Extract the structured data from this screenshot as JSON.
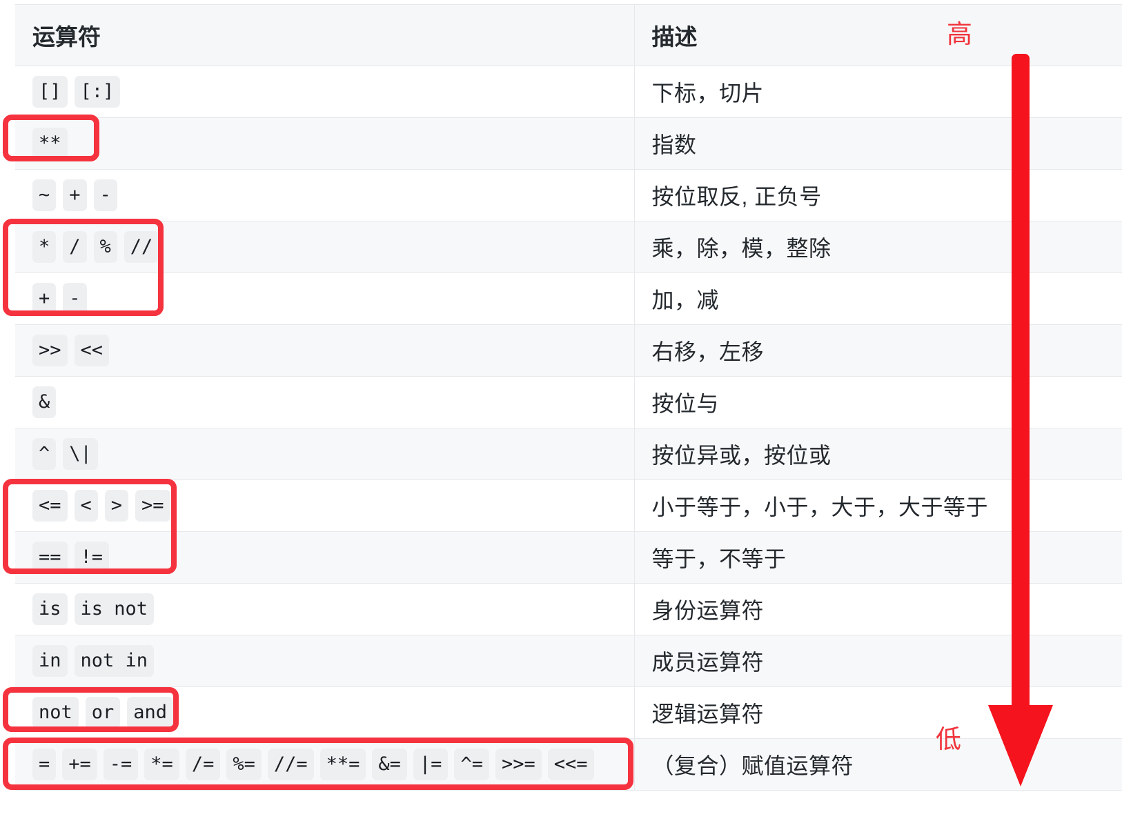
{
  "table": {
    "columns": [
      {
        "key": "operator",
        "label": "运算符"
      },
      {
        "key": "description",
        "label": "描述"
      }
    ],
    "rows": [
      {
        "tokens": [
          "[]",
          "[:]"
        ],
        "description": "下标，切片"
      },
      {
        "tokens": [
          "**"
        ],
        "description": "指数"
      },
      {
        "tokens": [
          "~",
          "+",
          "-"
        ],
        "description": "按位取反, 正负号"
      },
      {
        "tokens": [
          "*",
          "/",
          "%",
          "//"
        ],
        "description": "乘，除，模，整除"
      },
      {
        "tokens": [
          "+",
          "-"
        ],
        "description": "加，减"
      },
      {
        "tokens": [
          ">>",
          "<<"
        ],
        "description": "右移，左移"
      },
      {
        "tokens": [
          "&"
        ],
        "description": "按位与"
      },
      {
        "tokens": [
          "^",
          "\\|"
        ],
        "description": "按位异或，按位或"
      },
      {
        "tokens": [
          "<=",
          "<",
          ">",
          ">="
        ],
        "description": "小于等于，小于，大于，大于等于"
      },
      {
        "tokens": [
          "==",
          "!="
        ],
        "description": "等于，不等于"
      },
      {
        "tokens": [
          "is",
          "is not"
        ],
        "description": "身份运算符"
      },
      {
        "tokens": [
          "in",
          "not in"
        ],
        "description": "成员运算符"
      },
      {
        "tokens": [
          "not",
          "or",
          "and"
        ],
        "description": "逻辑运算符"
      },
      {
        "tokens": [
          "=",
          "+=",
          "-=",
          "*=",
          "/=",
          "%=",
          "//=",
          "**=",
          "&=",
          "|=",
          "^=",
          ">>=",
          "<<="
        ],
        "description": "（复合）赋值运算符"
      }
    ]
  },
  "annotations": {
    "accent_color": "#f5333f",
    "priority_high_label": "高",
    "priority_low_label": "低",
    "arrow_direction": "down",
    "boxes": [
      {
        "id": "box-exponent",
        "rows": [
          1,
          1
        ]
      },
      {
        "id": "box-muldiv-addsub",
        "rows": [
          3,
          4
        ]
      },
      {
        "id": "box-comparison",
        "rows": [
          8,
          9
        ]
      },
      {
        "id": "box-logical",
        "rows": [
          12,
          12
        ]
      },
      {
        "id": "box-assignment",
        "rows": [
          13,
          13
        ]
      }
    ]
  }
}
